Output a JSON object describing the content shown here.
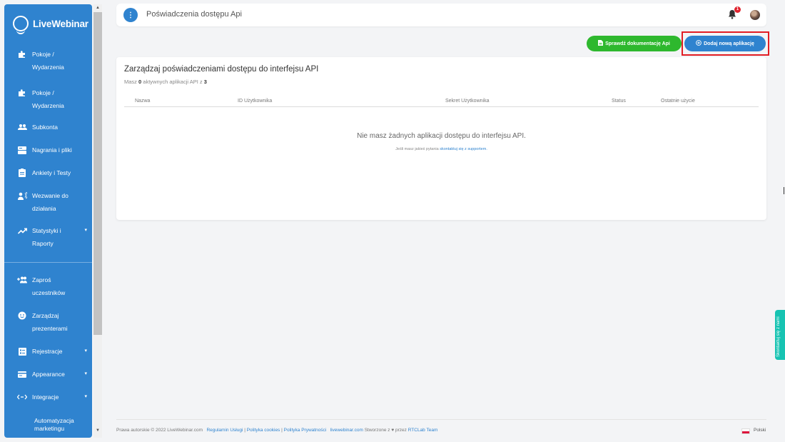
{
  "brand": {
    "name": "LiveWebinar"
  },
  "sidebar": {
    "items": [
      {
        "label_line1": "Pokoje /",
        "label_line2": "Wydarzenia",
        "icon": "puzzle-icon"
      },
      {
        "label_line1": "Pokoje /",
        "label_line2": "Wydarzenia",
        "icon": "puzzle-icon"
      },
      {
        "label": "Subkonta",
        "icon": "users-icon"
      },
      {
        "label": "Nagrania i pliki",
        "icon": "storage-icon"
      },
      {
        "label": "Ankiety i Testy",
        "icon": "clipboard-icon"
      },
      {
        "label_line1": "Wezwanie do",
        "label_line2": "działania",
        "icon": "megaphone-icon"
      },
      {
        "label_line1": "Statystyki i",
        "label_line2": "Raporty",
        "icon": "trend-icon",
        "caret": "▾"
      },
      {
        "label_line1": "Zaproś",
        "label_line2": "uczestników",
        "icon": "invite-icon"
      },
      {
        "label_line1": "Zarządzaj",
        "label_line2": "prezenterami",
        "icon": "presenter-icon"
      },
      {
        "label": "Rejestracje",
        "icon": "form-icon",
        "caret": "▾"
      },
      {
        "label": "Appearance",
        "icon": "card-icon",
        "caret": "▾"
      },
      {
        "label": "Integracje",
        "icon": "arrows-icon",
        "caret": "▾"
      }
    ],
    "sub_item": {
      "label_line1": "Automatyzacja",
      "label_line2": "marketingu"
    }
  },
  "topbar": {
    "menu_icon": "⋮",
    "title": "Poświadczenia dostępu Api",
    "notification_count": "1"
  },
  "actions": {
    "docs_label": "Sprawdź dokumentację Api",
    "add_label": "Dodaj nową aplikację"
  },
  "card": {
    "title": "Zarządzaj poświadczeniami dostępu do interfejsu API",
    "subtitle_pre": "Masz ",
    "active_count": "0",
    "subtitle_mid": " aktywnych aplikacji API z ",
    "max_count": "3",
    "columns": [
      "Nazwa",
      "ID Użytkownika",
      "Sekret Użytkownika",
      "Status",
      "Ostatnie użycie"
    ],
    "empty_message": "Nie masz żadnych aplikacji dostępu do interfejsu API.",
    "empty_hint_pre": "Jeśli masz jakieś pytania ",
    "empty_hint_link": "skontaktuj się z supportem."
  },
  "footer": {
    "copyright": "Prawa autorskie © 2022 LiveWebinar.com",
    "link_terms": "Regulamin Usługi",
    "link_cookies": "Polityka cookies",
    "link_privacy": "Polityka Prywatności",
    "site": "livewebinar.com",
    "made_by_pre": "Stworzone z",
    "made_by_post": "przez",
    "team": "RTCLab Team",
    "language": "Polski"
  },
  "feedback_tab": {
    "label": "Skontaktuj się z nami"
  },
  "colors": {
    "primary": "#2f83cf",
    "success": "#2eb82e",
    "badge": "#e0242f",
    "highlight": "#e21d24",
    "feedback": "#17c3b2"
  }
}
